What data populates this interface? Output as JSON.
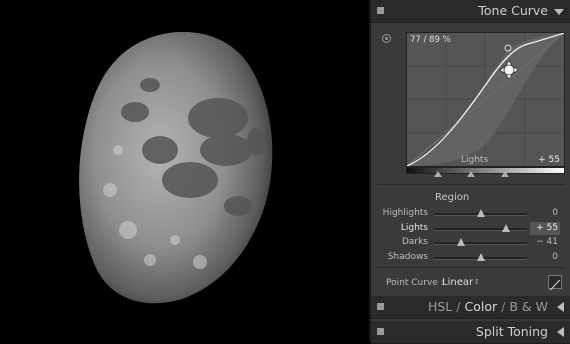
{
  "panel": {
    "tone_curve": {
      "title": "Tone Curve",
      "readout": "77 / 89 %",
      "graph_label": "Lights",
      "graph_value": "+ 55",
      "region_title": "Region",
      "sliders": [
        {
          "label": "Highlights",
          "value": "0",
          "level": 0.5,
          "active": false
        },
        {
          "label": "Lights",
          "value": "+ 55",
          "level": 0.775,
          "active": true
        },
        {
          "label": "Darks",
          "value": "− 41",
          "level": 0.295,
          "active": false
        },
        {
          "label": "Shadows",
          "value": "0",
          "level": 0.5,
          "active": false
        }
      ],
      "point_curve_label": "Point Curve :",
      "point_curve_value": "Linear",
      "point_curve_arrow": "↕"
    },
    "hsl_header": {
      "hsl": "HSL",
      "color": "Color",
      "bw": "B & W",
      "active": "Color"
    },
    "split_toning": {
      "title": "Split Toning"
    }
  },
  "icons": {
    "targeted_adjust": "target-icon",
    "collapse": "triangle-down-icon",
    "expand": "triangle-left-icon",
    "cursor": "move-cursor-icon"
  },
  "colors": {
    "panel_bg": "#3a3a3a",
    "header_bg": "#2a2a2a",
    "graph_bg": "#555555",
    "photo_bg": "#000000"
  }
}
